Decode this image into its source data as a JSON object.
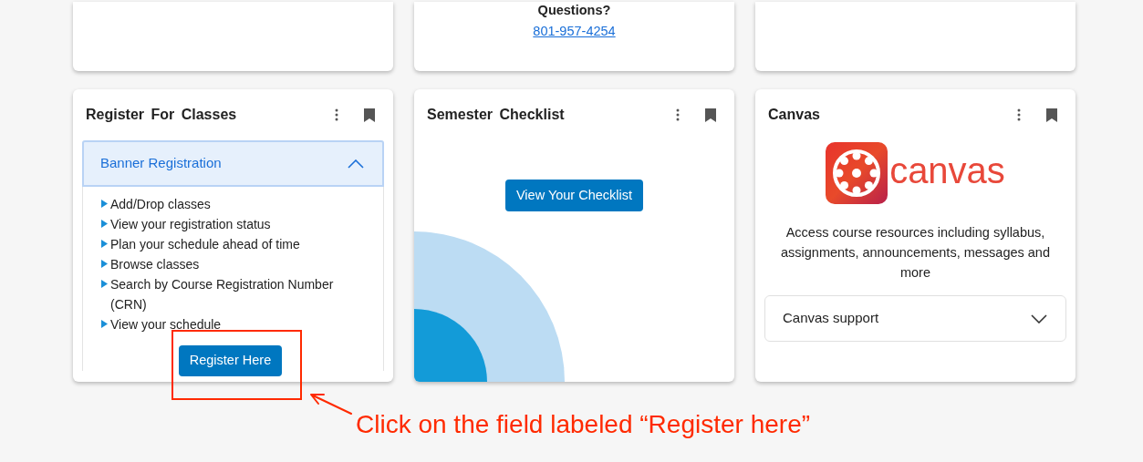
{
  "questions_card": {
    "heading": "Questions?",
    "phone": "801-957-4254"
  },
  "cards": [
    {
      "kind": "register",
      "title": "Register For Classes",
      "accordion": {
        "title": "Banner Registration",
        "expanded": true,
        "items": [
          {
            "text": "Add/Drop classes"
          },
          {
            "text": "View your registration status"
          },
          {
            "text": "Plan your schedule ahead of time"
          },
          {
            "text": "Browse classes"
          },
          {
            "text": "Search by Course Registration Number (CRN)"
          },
          {
            "text": "View your schedule"
          }
        ]
      },
      "button": "Register Here"
    },
    {
      "kind": "checklist",
      "title": "Semester Checklist",
      "button": "View Your Checklist"
    },
    {
      "kind": "canvas",
      "title": "Canvas",
      "logo_text": "canvas",
      "description": "Access course resources including syllabus, assignments, announcements, messages and more",
      "accordion": {
        "title": "Canvas support",
        "expanded": false
      }
    }
  ],
  "annotation": {
    "text": "Click on the field labeled “Register here”"
  }
}
